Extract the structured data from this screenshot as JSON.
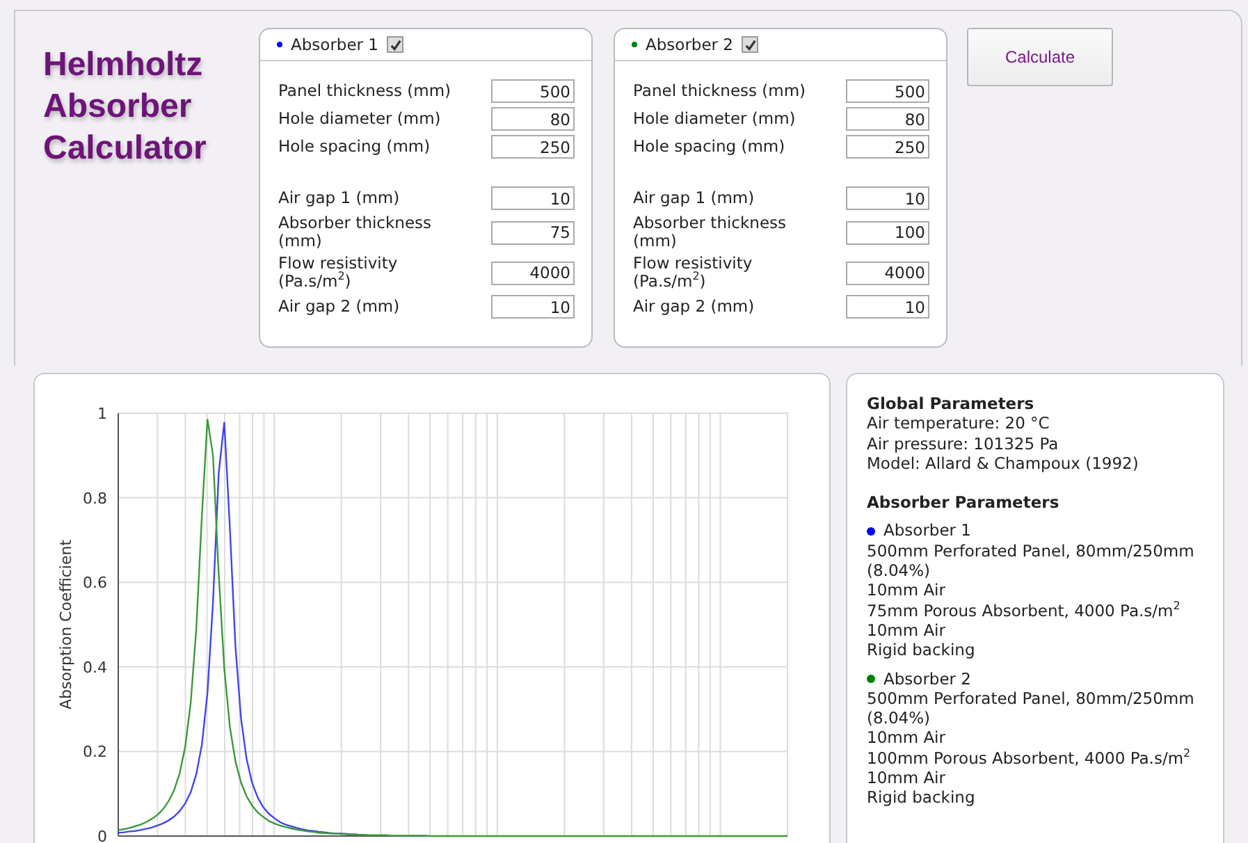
{
  "title": "Helmholtz Absorber Calculator",
  "absorbers": [
    {
      "name": "Absorber 1",
      "color": "#0000ff",
      "checked": true,
      "groups": [
        [
          {
            "label": "Panel thickness (mm)",
            "value": "500"
          },
          {
            "label": "Hole diameter (mm)",
            "value": "80"
          },
          {
            "label": "Hole spacing (mm)",
            "value": "250"
          }
        ],
        [
          {
            "label": "Air gap 1 (mm)",
            "value": "10"
          },
          {
            "label": "Absorber thickness (mm)",
            "value": "75"
          },
          {
            "label": "Flow resistivity (Pa.s/m$^{2}$)",
            "value": "4000"
          },
          {
            "label": "Air gap 2 (mm)",
            "value": "10"
          }
        ]
      ]
    },
    {
      "name": "Absorber 2",
      "color": "#008000",
      "checked": true,
      "groups": [
        [
          {
            "label": "Panel thickness (mm)",
            "value": "500"
          },
          {
            "label": "Hole diameter (mm)",
            "value": "80"
          },
          {
            "label": "Hole spacing (mm)",
            "value": "250"
          }
        ],
        [
          {
            "label": "Air gap 1 (mm)",
            "value": "10"
          },
          {
            "label": "Absorber thickness (mm)",
            "value": "100"
          },
          {
            "label": "Flow resistivity (Pa.s/m$^{2}$)",
            "value": "4000"
          },
          {
            "label": "Air gap 2 (mm)",
            "value": "10"
          }
        ]
      ]
    }
  ],
  "calculate_button": "Calculate",
  "chart": {
    "chart_data": {
      "type": "line",
      "grid": true,
      "ylabel": "Absorption Coefficient",
      "ylim": [
        0,
        1
      ],
      "yticks": [
        0,
        0.2,
        0.4,
        0.6,
        0.8,
        1
      ],
      "categories": [
        null,
        null,
        null,
        null,
        null,
        null,
        null,
        null,
        null,
        null,
        null,
        null,
        null,
        null,
        null,
        null,
        null,
        null,
        null,
        null,
        null,
        null,
        null,
        null,
        null,
        null,
        null,
        null,
        null,
        null,
        null,
        null,
        null,
        null,
        null,
        null,
        null,
        null,
        null,
        null,
        null,
        null,
        null,
        null,
        null,
        null,
        null,
        null,
        null,
        null,
        null,
        null,
        null,
        null,
        null,
        null,
        null,
        null,
        null,
        null,
        null,
        null,
        null,
        null,
        null,
        null,
        null,
        null,
        null,
        null,
        null,
        null,
        null,
        null,
        null,
        null,
        null,
        null,
        null,
        null,
        null,
        null,
        null,
        null,
        null,
        null,
        null,
        null,
        null,
        null,
        null,
        null,
        null,
        null,
        null,
        null,
        null,
        null,
        null,
        null,
        null,
        null,
        null,
        null,
        null,
        null,
        null,
        null,
        null,
        null,
        null,
        null,
        null,
        null,
        null,
        null,
        null,
        null,
        null,
        null,
        null
      ],
      "series": [
        {
          "color": "#4444ee",
          "values": [
            0.008,
            0.009,
            0.011,
            0.012,
            0.014,
            0.017,
            0.02,
            0.025,
            0.03,
            0.037,
            0.046,
            0.059,
            0.077,
            0.104,
            0.146,
            0.216,
            0.338,
            0.553,
            0.858,
            0.979,
            0.73,
            0.45,
            0.279,
            0.183,
            0.126,
            0.091,
            0.068,
            0.053,
            0.042,
            0.033,
            0.027,
            0.023,
            0.019,
            0.016,
            0.013,
            0.012,
            0.01,
            0.009,
            0.007,
            0.006,
            0.006,
            0.005,
            0.004,
            0.004,
            null,
            null,
            null,
            null,
            null,
            null,
            null,
            null,
            null,
            null,
            null,
            null,
            null,
            null,
            null,
            null,
            null,
            null,
            null,
            null,
            null,
            null,
            null,
            null,
            null,
            null,
            null,
            null,
            null,
            null,
            null,
            null,
            null,
            null,
            null,
            null,
            null,
            null,
            null,
            null,
            null,
            null,
            null,
            null,
            null,
            null,
            null,
            null,
            null,
            null,
            null,
            null,
            null,
            null,
            null,
            null,
            null,
            null,
            null,
            null,
            null,
            null,
            null,
            null,
            null,
            null,
            null,
            null,
            null,
            null,
            null,
            null,
            null,
            null,
            null,
            null,
            null
          ]
        },
        {
          "color": "#3a9a3a",
          "values": [
            0.014,
            0.016,
            0.019,
            0.023,
            0.027,
            0.033,
            0.04,
            0.05,
            0.063,
            0.082,
            0.108,
            0.148,
            0.211,
            0.316,
            0.491,
            0.757,
            0.986,
            0.9,
            0.62,
            0.396,
            0.259,
            0.177,
            0.127,
            0.094,
            0.072,
            0.056,
            0.045,
            0.036,
            0.03,
            0.025,
            0.021,
            0.018,
            0.015,
            0.013,
            0.011,
            0.01,
            0.008,
            0.007,
            0.006,
            0.006,
            0.005,
            0.004,
            0.004,
            0.003,
            0.003,
            0.002,
            0.002,
            0.002,
            0.002,
            0.001,
            0.001,
            0.001,
            0.001,
            0.001,
            0.001,
            0.001,
            0,
            0,
            0,
            0,
            0,
            0,
            0,
            0,
            0,
            0,
            0,
            0,
            0,
            0,
            0,
            0,
            0,
            0,
            0,
            0,
            0,
            0,
            0,
            0,
            0,
            0,
            0,
            0,
            0,
            0,
            0,
            0,
            0,
            0,
            0,
            0,
            0,
            0,
            0,
            0,
            0,
            0,
            0,
            0,
            0,
            0,
            0,
            0,
            0,
            0,
            0,
            0,
            0,
            0,
            0,
            0,
            0,
            0,
            0,
            0,
            0,
            0,
            0,
            0,
            0
          ]
        }
      ]
    }
  },
  "info": {
    "global_heading": "Global Parameters",
    "global_lines": [
      "Air temperature: 20 °C",
      "Air pressure: 101325 Pa",
      "Model: Allard & Champoux (1992)"
    ],
    "absorber_heading": "Absorber Parameters",
    "entries": [
      {
        "name": "Absorber 1",
        "color": "#0000ff",
        "lines": [
          "500mm Perforated Panel, 80mm/250mm (8.04%)",
          "10mm Air",
          "75mm Porous Absorbent, 4000 Pa.s/m$^{2}$",
          "10mm Air",
          "Rigid backing"
        ]
      },
      {
        "name": "Absorber 2",
        "color": "#008000",
        "lines": [
          "500mm Perforated Panel, 80mm/250mm (8.04%)",
          "10mm Air",
          "100mm Porous Absorbent, 4000 Pa.s/m$^{2}$",
          "10mm Air",
          "Rigid backing"
        ]
      }
    ]
  }
}
